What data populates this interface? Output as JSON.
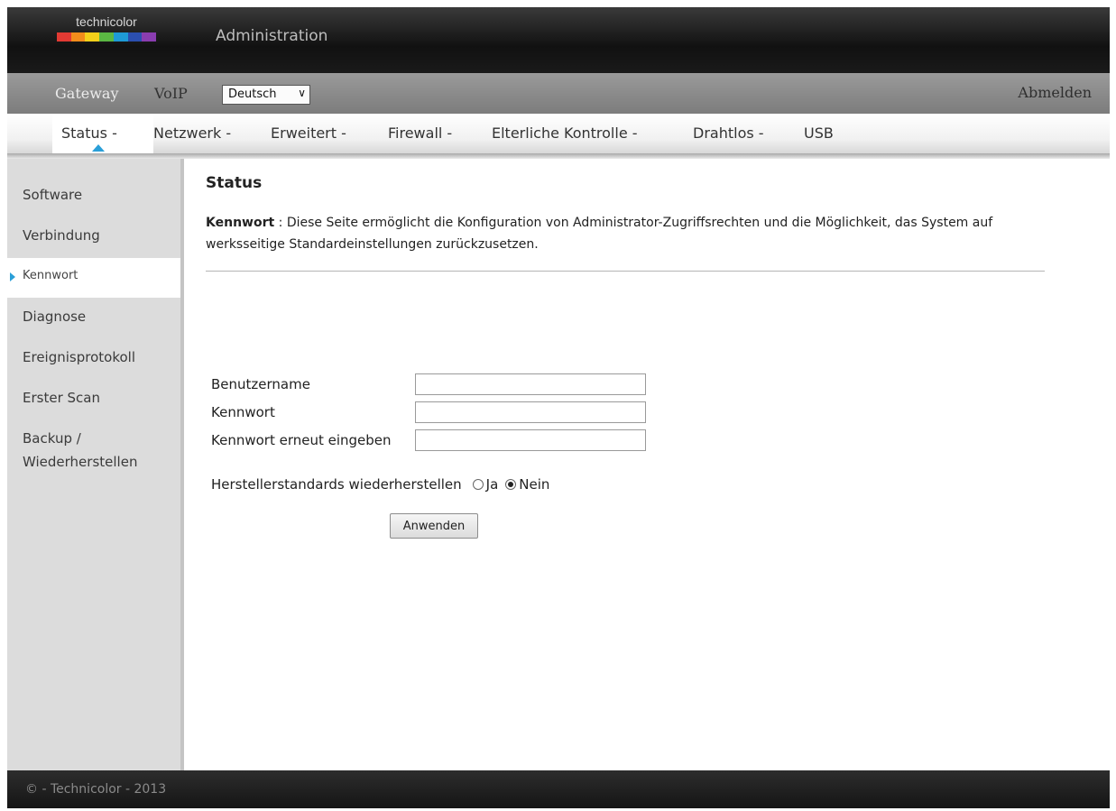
{
  "header": {
    "logo_text": "technicolor",
    "logo_colors": [
      "#e23a33",
      "#f28c1b",
      "#f4d01a",
      "#5bb743",
      "#1e9ad6",
      "#2b4fb0",
      "#8a3db0"
    ],
    "title": "Administration"
  },
  "topnav": {
    "gateway": "Gateway",
    "voip": "VoIP",
    "language": "Deutsch",
    "logout": "Abmelden"
  },
  "tabs": [
    {
      "label": "Status -",
      "active": true
    },
    {
      "label": "Netzwerk -"
    },
    {
      "label": "Erweitert -"
    },
    {
      "label": "Firewall -"
    },
    {
      "label": "Elterliche Kontrolle -"
    },
    {
      "label": "Drahtlos -"
    },
    {
      "label": "USB"
    }
  ],
  "sidebar": {
    "items": [
      {
        "label": "Software"
      },
      {
        "label": "Verbindung"
      },
      {
        "label": "Kennwort",
        "active": true
      },
      {
        "label": "Diagnose"
      },
      {
        "label": "Ereignisprotokoll"
      },
      {
        "label": "Erster Scan"
      },
      {
        "label": "Backup /"
      },
      {
        "label": "Wiederherstellen"
      }
    ]
  },
  "main": {
    "title": "Status",
    "desc_label": "Kennwort",
    "desc_sep": " : ",
    "desc_text": "Diese Seite ermöglicht die Konfiguration von Administrator-Zugriffsrechten und die Möglichkeit, das System auf werksseitige Standardeinstellungen zurückzusetzen.",
    "fields": [
      {
        "label": "Benutzername",
        "value": ""
      },
      {
        "label": "Kennwort",
        "value": ""
      },
      {
        "label": "Kennwort erneut eingeben",
        "value": ""
      }
    ],
    "reset_label": "Herstellerstandards wiederherstellen",
    "option_yes": "Ja",
    "option_no": "Nein",
    "selected": "Nein",
    "apply_label": "Anwenden"
  },
  "footer": {
    "text": "© - Technicolor - 2013"
  },
  "colors": {
    "accent": "#2a9fd8"
  }
}
